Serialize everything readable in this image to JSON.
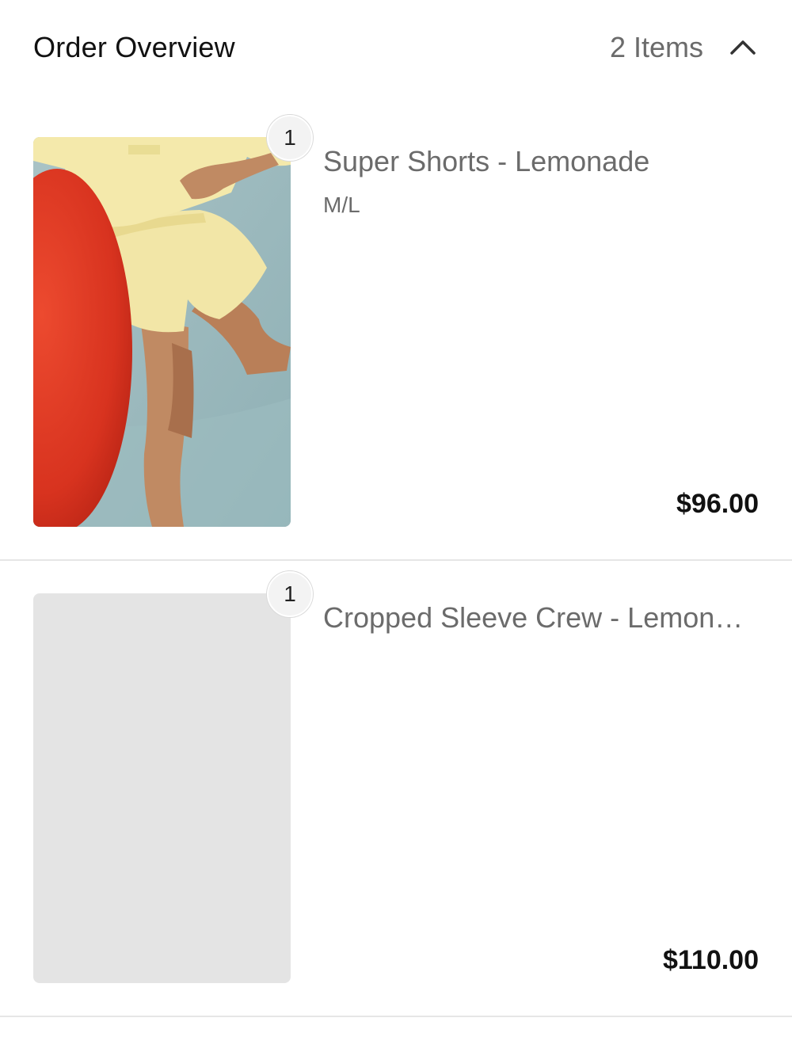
{
  "header": {
    "title": "Order Overview",
    "item_count": "2 Items",
    "toggle_icon": "chevron-up-icon"
  },
  "items": [
    {
      "quantity": "1",
      "name": "Super Shorts - Lemonade",
      "variant": "M/L",
      "price": "$96.00",
      "image_loaded": true
    },
    {
      "quantity": "1",
      "name": "Cropped Sleeve Crew - Lemonade",
      "variant": "",
      "price": "$110.00",
      "image_loaded": false
    }
  ],
  "colors": {
    "background": "#ffffff",
    "text_primary": "#111111",
    "text_secondary": "#6b6b6b",
    "divider": "#e6e6e6",
    "placeholder": "#e4e4e4"
  }
}
